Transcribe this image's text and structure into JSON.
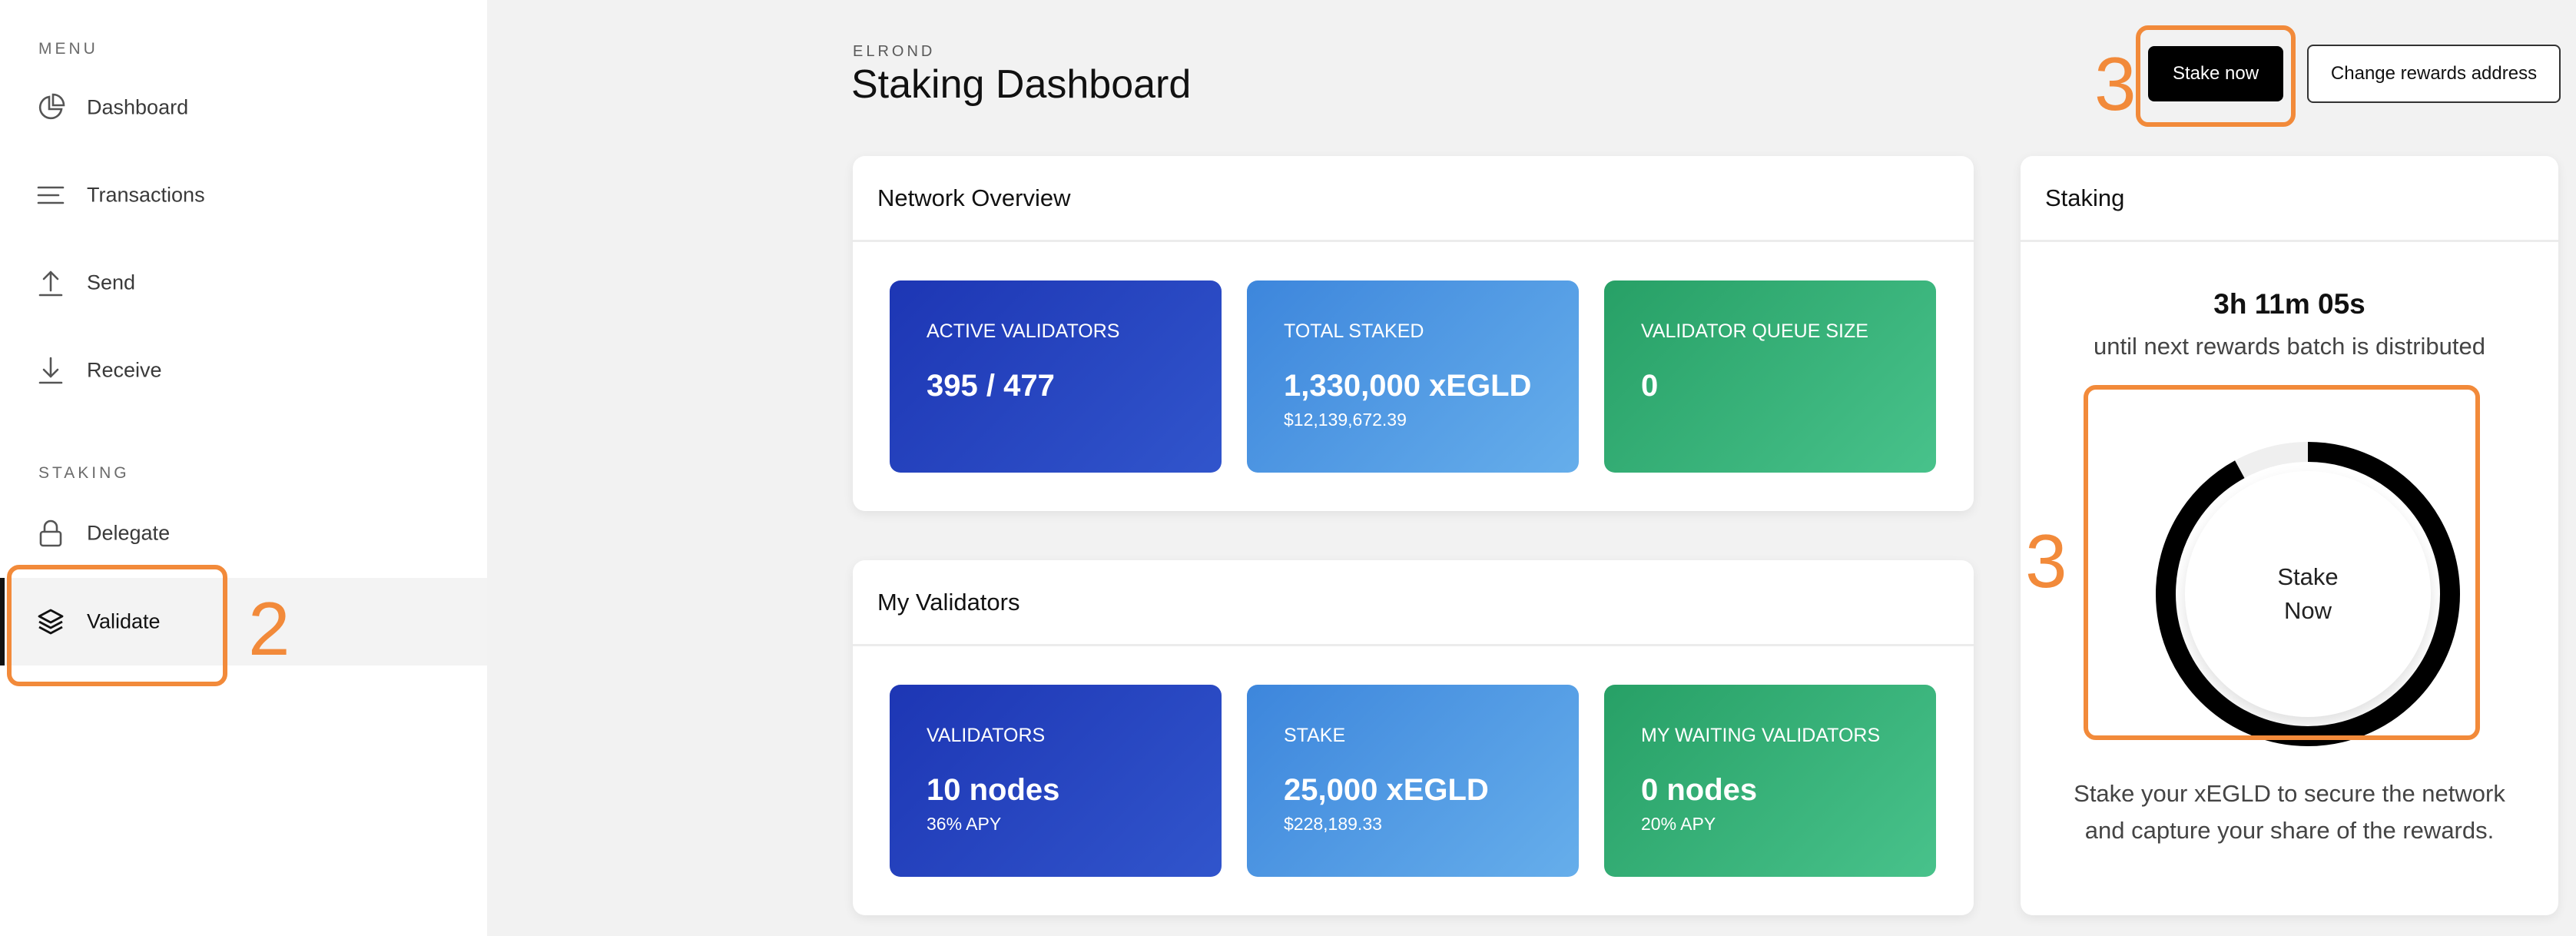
{
  "sidebar": {
    "menu_label": "MENU",
    "staking_label": "STAKING",
    "items": [
      {
        "label": "Dashboard",
        "icon": "pie-chart-icon"
      },
      {
        "label": "Transactions",
        "icon": "list-icon"
      },
      {
        "label": "Send",
        "icon": "upload-icon"
      },
      {
        "label": "Receive",
        "icon": "download-icon"
      },
      {
        "label": "Delegate",
        "icon": "lock-icon"
      },
      {
        "label": "Validate",
        "icon": "layers-icon",
        "active": true
      }
    ]
  },
  "annotations": {
    "sidebar_step": "2",
    "stake_button_step": "3",
    "ring_step": "3",
    "color": "#f28a3a"
  },
  "header": {
    "eyebrow": "ELROND",
    "title": "Staking Dashboard",
    "stake_now_label": "Stake now",
    "change_rewards_label": "Change rewards address"
  },
  "network_overview": {
    "title": "Network Overview",
    "stats": [
      {
        "label": "ACTIVE VALIDATORS",
        "value": "395 / 477",
        "sub": ""
      },
      {
        "label": "TOTAL STAKED",
        "value": "1,330,000 xEGLD",
        "sub": "$12,139,672.39"
      },
      {
        "label": "VALIDATOR QUEUE SIZE",
        "value": "0",
        "sub": ""
      }
    ]
  },
  "my_validators": {
    "title": "My Validators",
    "stats": [
      {
        "label": "VALIDATORS",
        "value": "10 nodes",
        "sub": "36% APY"
      },
      {
        "label": "STAKE",
        "value": "25,000 xEGLD",
        "sub": "$228,189.33"
      },
      {
        "label": "MY WAITING VALIDATORS",
        "value": "0 nodes",
        "sub": "20% APY"
      }
    ]
  },
  "staking": {
    "title": "Staking",
    "countdown": "3h 11m 05s",
    "countdown_sub": "until next rewards batch is distributed",
    "ring_progress": 0.92,
    "ring_line1": "Stake",
    "ring_line2": "Now",
    "description_line1": "Stake your xEGLD to secure the network",
    "description_line2": "and capture your share of the rewards."
  },
  "colors": {
    "accent_blue": "#1d36b4",
    "accent_sky": "#4a96e2",
    "accent_green": "#2fab70",
    "annotation": "#f28a3a"
  }
}
